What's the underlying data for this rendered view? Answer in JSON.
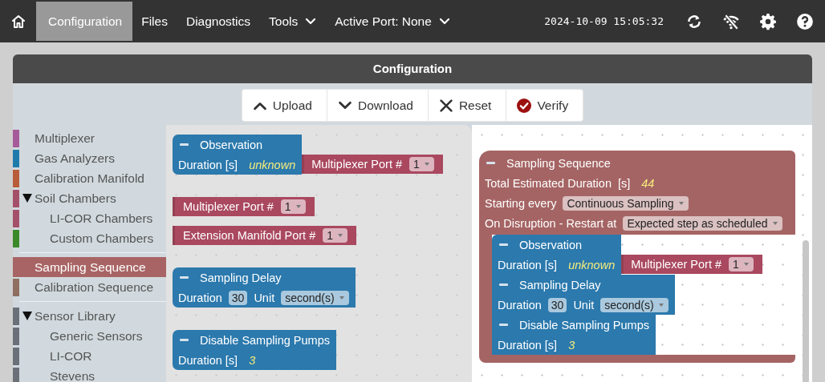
{
  "navbar": {
    "items": [
      {
        "label": "Configuration",
        "selected": true,
        "kind": "link"
      },
      {
        "label": "Files",
        "selected": false,
        "kind": "link"
      },
      {
        "label": "Diagnostics",
        "selected": false,
        "kind": "link"
      },
      {
        "label": "Tools",
        "selected": false,
        "kind": "menu"
      },
      {
        "label": "Active Port: None",
        "selected": false,
        "kind": "menu"
      }
    ],
    "clock": "2024-10-09 15:05:32"
  },
  "panel": {
    "title": "Configuration"
  },
  "toolbar": [
    {
      "label": "Upload"
    },
    {
      "label": "Download"
    },
    {
      "label": "Reset"
    },
    {
      "label": "Verify"
    }
  ],
  "categories": [
    {
      "items": [
        {
          "label": "Multiplexer",
          "color": "#a55b99",
          "selected": false
        },
        {
          "label": "Gas Analyzers",
          "color": "#1f7aac",
          "selected": false
        },
        {
          "label": "Calibration Manifold",
          "color": "#b85c3c",
          "selected": false
        },
        {
          "label": "Soil Chambers",
          "color": "#a5506a",
          "selected": false,
          "expanded": true,
          "children": [
            {
              "label": "LI-COR Chambers",
              "color": "#a5506a",
              "selected": false
            },
            {
              "label": "Custom Chambers",
              "color": "#3b8a2a",
              "selected": false
            }
          ]
        }
      ]
    },
    {
      "items": [
        {
          "label": "Sampling Sequence",
          "selected": true
        },
        {
          "label": "Calibration Sequence",
          "color": "#8e6f62",
          "selected": false
        }
      ]
    },
    {
      "items": [
        {
          "label": "Sensor Library",
          "color": "#6b7078",
          "selected": false,
          "expanded": true,
          "children": [
            {
              "label": "Generic Sensors",
              "color": "#6b7078",
              "selected": false
            },
            {
              "label": "LI-COR",
              "color": "#6b7078",
              "selected": false
            },
            {
              "label": "Stevens",
              "color": "#6b7078",
              "selected": false
            }
          ]
        }
      ]
    }
  ],
  "flyout": [
    {
      "kind": "statement",
      "color": "#2b79ad",
      "title": "Observation",
      "rows": [
        {
          "fields": [
            {
              "kind": "label",
              "text": "Duration [s]"
            },
            {
              "kind": "readout",
              "text": "unknown"
            }
          ],
          "input": {
            "kind": "value",
            "color": "#a9485f",
            "fields": [
              {
                "kind": "label",
                "text": "Multiplexer Port #"
              },
              {
                "kind": "dropdown",
                "text": "1"
              }
            ]
          }
        }
      ]
    },
    {
      "kind": "value",
      "color": "#a9485f",
      "fields": [
        {
          "kind": "label",
          "text": "Multiplexer Port #"
        },
        {
          "kind": "dropdown",
          "text": "1"
        }
      ]
    },
    {
      "kind": "value",
      "color": "#a9485f",
      "fields": [
        {
          "kind": "label",
          "text": "Extension Manifold Port #"
        },
        {
          "kind": "dropdown",
          "text": "1"
        }
      ]
    },
    {
      "kind": "statement",
      "color": "#2b79ad",
      "title": "Sampling Delay",
      "rows": [
        {
          "fields": [
            {
              "kind": "label",
              "text": "Duration"
            },
            {
              "kind": "number",
              "text": "30"
            },
            {
              "kind": "label",
              "text": "Unit"
            },
            {
              "kind": "dropdown",
              "text": "second(s)"
            }
          ]
        }
      ]
    },
    {
      "kind": "statement",
      "color": "#2b79ad",
      "title": "Disable Sampling Pumps",
      "rows": [
        {
          "fields": [
            {
              "kind": "label",
              "text": "Duration [s]"
            },
            {
              "kind": "readout",
              "text": "3"
            }
          ]
        }
      ]
    }
  ],
  "workspace": [
    {
      "kind": "sequence",
      "color": "#a56464",
      "title": "Sampling Sequence",
      "rows": [
        {
          "fields": [
            {
              "kind": "label",
              "text": "Total Estimated Duration"
            },
            {
              "kind": "label",
              "text": "[s]"
            },
            {
              "kind": "readout",
              "text": "44"
            }
          ]
        },
        {
          "fields": [
            {
              "kind": "label",
              "text": "Starting every"
            },
            {
              "kind": "dropdown",
              "text": "Continuous Sampling"
            }
          ]
        },
        {
          "fields": [
            {
              "kind": "label",
              "text": "On Disruption - Restart at"
            },
            {
              "kind": "dropdown",
              "text": "Expected step as scheduled"
            }
          ]
        }
      ],
      "statements": [
        {
          "kind": "statement",
          "color": "#2b79ad",
          "title": "Observation",
          "rows": [
            {
              "fields": [
                {
                  "kind": "label",
                  "text": "Duration [s]"
                },
                {
                  "kind": "readout",
                  "text": "unknown"
                }
              ],
              "input": {
                "kind": "value",
                "color": "#a9485f",
                "fields": [
                  {
                    "kind": "label",
                    "text": "Multiplexer Port #"
                  },
                  {
                    "kind": "dropdown",
                    "text": "1"
                  }
                ]
              }
            }
          ]
        },
        {
          "kind": "statement",
          "color": "#2b79ad",
          "title": "Sampling Delay",
          "rows": [
            {
              "fields": [
                {
                  "kind": "label",
                  "text": "Duration"
                },
                {
                  "kind": "number",
                  "text": "30"
                },
                {
                  "kind": "label",
                  "text": "Unit"
                },
                {
                  "kind": "dropdown",
                  "text": "second(s)"
                }
              ]
            }
          ]
        },
        {
          "kind": "statement",
          "color": "#2b79ad",
          "title": "Disable Sampling Pumps",
          "rows": [
            {
              "fields": [
                {
                  "kind": "label",
                  "text": "Duration [s]"
                },
                {
                  "kind": "readout",
                  "text": "3"
                }
              ]
            }
          ]
        }
      ]
    }
  ]
}
